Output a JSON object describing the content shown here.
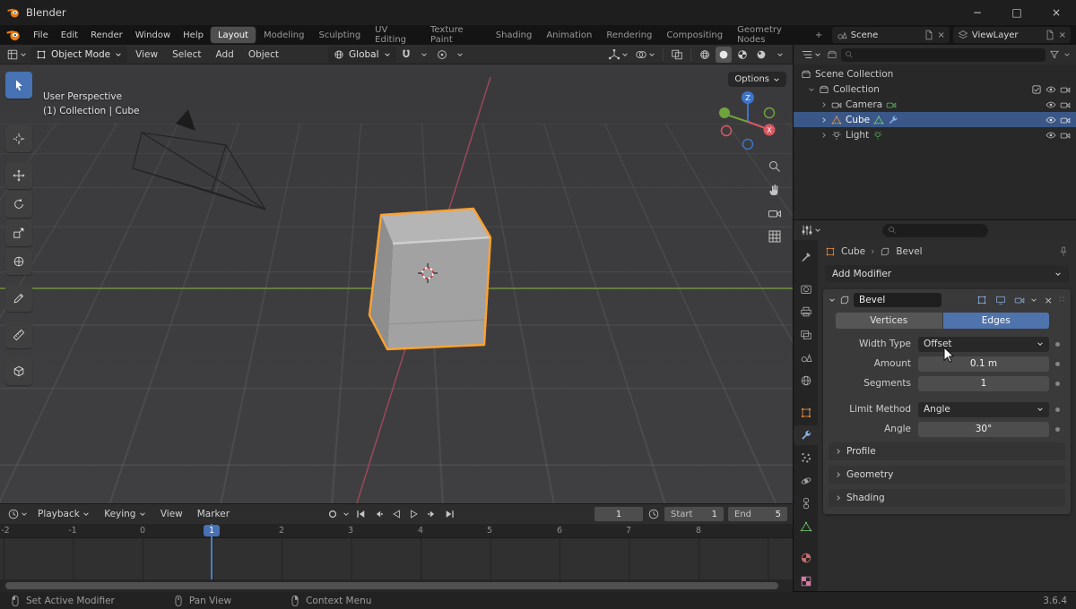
{
  "colors": {
    "accent": "#4772b3",
    "selection_highlight": "#3a5787",
    "object_outline": "#ffa230",
    "axis_red": "#a0485a",
    "axis_green": "#70923e"
  },
  "window": {
    "title": "Blender",
    "minimize": "−",
    "maximize": "□",
    "close": "×"
  },
  "topbar": {
    "menus": [
      "File",
      "Edit",
      "Render",
      "Window",
      "Help"
    ],
    "workspaces": [
      "Layout",
      "Modeling",
      "Sculpting",
      "UV Editing",
      "Texture Paint",
      "Shading",
      "Animation",
      "Rendering",
      "Compositing",
      "Geometry Nodes"
    ],
    "add_workspace": "+",
    "scene_label": "Scene",
    "view_layer_label": "ViewLayer"
  },
  "tool_header": {
    "mode": "Object Mode",
    "menus": [
      "View",
      "Select",
      "Add",
      "Object"
    ],
    "orientation": "Global"
  },
  "viewport": {
    "view_label": "User Perspective",
    "context_label": "(1) Collection | Cube",
    "options_label": "Options",
    "gizmo": {
      "x": "X",
      "z": "Z"
    }
  },
  "tools": [
    "select-box",
    "cursor",
    "move",
    "rotate",
    "scale",
    "transform",
    "annotate",
    "measure",
    "add-cube"
  ],
  "outliner": {
    "rows": [
      {
        "label": "Scene Collection"
      },
      {
        "label": "Collection"
      },
      {
        "label": "Camera"
      },
      {
        "label": "Cube"
      },
      {
        "label": "Light"
      }
    ],
    "selected": "Cube"
  },
  "properties": {
    "tabs": [
      "tool",
      "render",
      "output",
      "view-layer",
      "scene",
      "world",
      "object",
      "modifiers",
      "particles",
      "physics",
      "constraints",
      "object-data",
      "material",
      "texture"
    ],
    "active_tab": "modifiers",
    "breadcrumb": {
      "object": "Cube",
      "separator": "›",
      "modifier": "Bevel"
    },
    "add_modifier_label": "Add Modifier",
    "bevel": {
      "name": "Bevel",
      "affect": [
        "Vertices",
        "Edges"
      ],
      "affect_active": "Edges",
      "fields": [
        {
          "label": "Width Type",
          "value": "Offset"
        },
        {
          "label": "Amount",
          "value": "0.1 m"
        },
        {
          "label": "Segments",
          "value": "1"
        },
        {
          "label": "Limit Method",
          "value": "Angle"
        },
        {
          "label": "Angle",
          "value": "30°"
        }
      ],
      "subpanels": [
        "Profile",
        "Geometry",
        "Shading"
      ]
    }
  },
  "timeline": {
    "menus": [
      "Playback",
      "Keying",
      "View",
      "Marker"
    ],
    "current_frame": "1",
    "start_label": "Start",
    "start_value": "1",
    "end_label": "End",
    "end_value": "5",
    "ruler": [
      "-2",
      "-1",
      "0",
      "1",
      "2",
      "3",
      "4",
      "5",
      "6",
      "7",
      "8"
    ]
  },
  "status_bar": {
    "hints": [
      "Set Active Modifier",
      "Pan View",
      "Context Menu"
    ],
    "version": "3.6.4"
  }
}
